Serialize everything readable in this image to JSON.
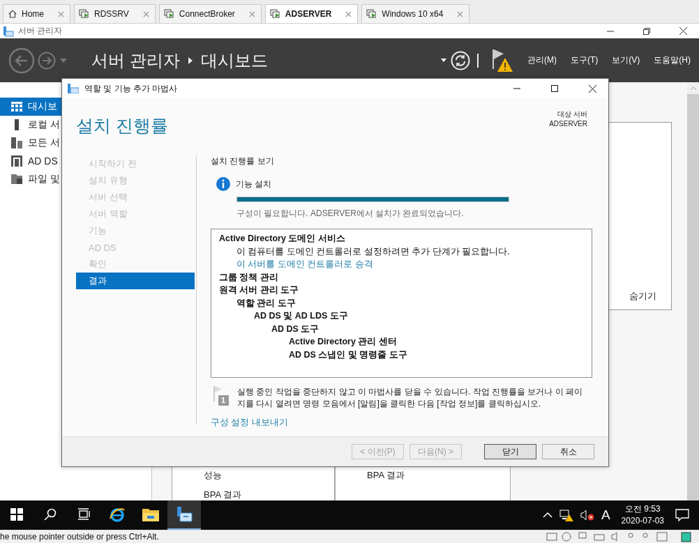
{
  "vm_tabs": [
    {
      "label": "Home",
      "kind": "home",
      "selected": false
    },
    {
      "label": "RDSSRV",
      "kind": "vm",
      "selected": false
    },
    {
      "label": "ConnectBroker",
      "kind": "vm",
      "selected": false
    },
    {
      "label": "ADSERVER",
      "kind": "vm",
      "selected": true
    },
    {
      "label": "Windows 10 x64",
      "kind": "vm",
      "selected": false
    }
  ],
  "window": {
    "title": "서버 관리자"
  },
  "header": {
    "breadcrumb": [
      "서버 관리자",
      "대시보드"
    ],
    "menus": [
      "관리(M)",
      "도구(T)",
      "보기(V)",
      "도움말(H)"
    ]
  },
  "sidebar": {
    "items": [
      {
        "label": "대시보",
        "kind": "dashboard",
        "selected": true
      },
      {
        "label": "로컬 서",
        "kind": "local",
        "selected": false
      },
      {
        "label": "모든 서",
        "kind": "all",
        "selected": false
      },
      {
        "label": "AD DS",
        "kind": "adds",
        "selected": false
      },
      {
        "label": "파일 및",
        "kind": "file",
        "selected": false
      }
    ]
  },
  "dashboard": {
    "hide_link": "숨기기",
    "tiles": [
      {
        "lines": [
          "성능",
          "BPA 결과"
        ]
      },
      {
        "lines": [
          "BPA 결과"
        ]
      }
    ]
  },
  "wizard": {
    "title": "역할 및 기능 추가 마법사",
    "heading": "설치 진행률",
    "target_label": "대상 서버",
    "target_server": "ADSERVER",
    "steps": [
      {
        "label": "시작하기 전",
        "selected": false
      },
      {
        "label": "설치 유형",
        "selected": false
      },
      {
        "label": "서버 선택",
        "selected": false
      },
      {
        "label": "서버 역할",
        "selected": false
      },
      {
        "label": "기능",
        "selected": false
      },
      {
        "label": "AD DS",
        "selected": false
      },
      {
        "label": "확인",
        "selected": false
      },
      {
        "label": "결과",
        "selected": true
      }
    ],
    "section_title": "설치 진행률 보기",
    "progress": {
      "label": "기능 설치",
      "level": 1,
      "message": "구성이 필요합니다. ADSERVER에서 설치가 완료되었습니다."
    },
    "results": [
      {
        "text": "Active Directory 도메인 서비스",
        "kind": "feature",
        "children": [
          {
            "text": "이 컴퓨터를 도메인 컨트롤러로 설정하려면 추가 단계가 필요합니다.",
            "kind": "message"
          },
          {
            "text": "이 서버를 도메인 컨트롤러로 승격",
            "kind": "link"
          }
        ]
      },
      {
        "text": "그룹 정책 관리",
        "kind": "feature"
      },
      {
        "text": "원격 서버 관리 도구",
        "kind": "feature",
        "children": [
          {
            "text": "역할 관리 도구",
            "kind": "feature",
            "children": [
              {
                "text": "AD DS 및 AD LDS 도구",
                "kind": "feature",
                "children": [
                  {
                    "text": "AD DS 도구",
                    "kind": "feature",
                    "children": [
                      {
                        "text": "Active Directory 관리 센터",
                        "kind": "feature"
                      },
                      {
                        "text": "AD DS 스냅인 및 명령줄 도구",
                        "kind": "feature"
                      }
                    ]
                  }
                ]
              }
            ]
          }
        ]
      }
    ],
    "note": {
      "badge": "1",
      "text": "실행 중인 작업을 중단하지 않고 이 마법사를 닫을 수 있습니다. 작업 진행률을 보거나 이 페이지를 다시 열려면 명령 모음에서 [알림]을 클릭한 다음 [작업 정보]를 클릭하십시오."
    },
    "export_link": "구성 설정 내보내기",
    "buttons": [
      {
        "label": "< 이전(P)",
        "disabled": true,
        "default": false
      },
      {
        "label": "다음(N) >",
        "disabled": true,
        "default": false
      },
      {
        "label": "닫기",
        "disabled": false,
        "default": true
      },
      {
        "label": "취소",
        "disabled": false,
        "default": false
      }
    ]
  },
  "taskbar": {
    "apps": [
      {
        "kind": "start",
        "selected": false
      },
      {
        "kind": "search",
        "selected": false
      },
      {
        "kind": "taskview",
        "selected": false
      },
      {
        "kind": "browser",
        "selected": false
      },
      {
        "kind": "explorer",
        "selected": false
      },
      {
        "kind": "servermanager",
        "selected": true
      }
    ],
    "ime": "A",
    "time": "오전 9:53",
    "date": "2020-07-03"
  },
  "status_bar": {
    "text": "he mouse pointer outside or press Ctrl+Alt."
  }
}
